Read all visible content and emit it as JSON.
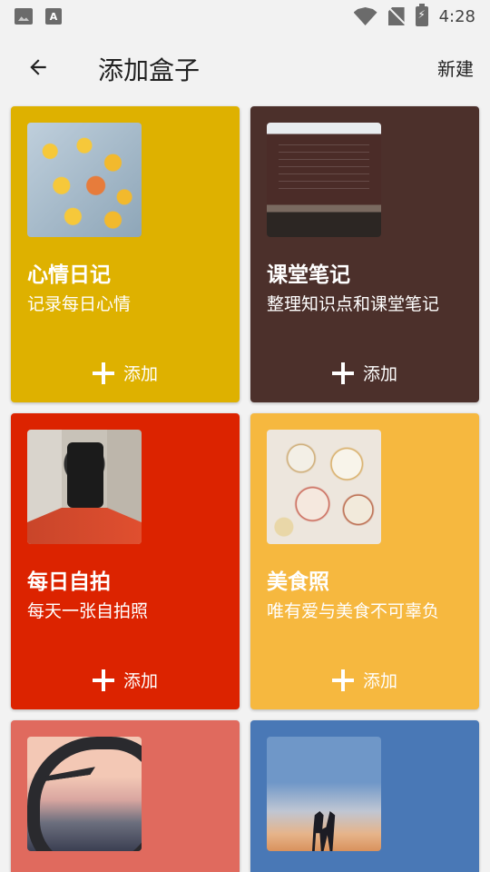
{
  "status_bar": {
    "time": "4:28"
  },
  "appbar": {
    "title": "添加盒子",
    "action": "新建"
  },
  "cards": [
    {
      "title": "心情日记",
      "subtitle": "记录每日心情",
      "add_label": "添加",
      "color": "#DEB100"
    },
    {
      "title": "课堂笔记",
      "subtitle": "整理知识点和课堂笔记",
      "add_label": "添加",
      "color": "#4C302B"
    },
    {
      "title": "每日自拍",
      "subtitle": "每天一张自拍照",
      "add_label": "添加",
      "color": "#DC2300"
    },
    {
      "title": "美食照",
      "subtitle": "唯有爱与美食不可辜负",
      "add_label": "添加",
      "color": "#F6B83F"
    },
    {
      "color": "#E06A5E"
    },
    {
      "color": "#4978B6"
    }
  ]
}
